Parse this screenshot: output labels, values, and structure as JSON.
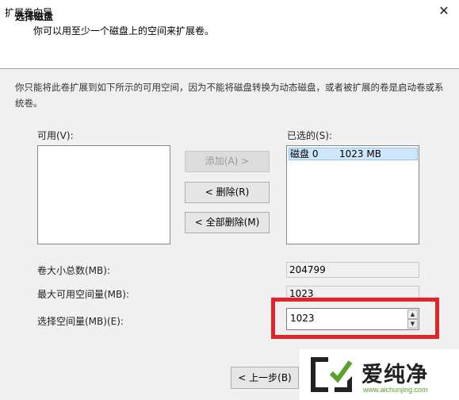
{
  "window": {
    "title": "扩展卷向导",
    "close_glyph": "✕"
  },
  "header": {
    "title": "选择磁盘",
    "subtitle": "你可以用至少一个磁盘上的空间来扩展卷。"
  },
  "description": "你只能将此卷扩展到如下所示的可用空间，因为不能将磁盘转换为动态磁盘，或者被扩展的卷是启动卷或系统卷。",
  "available": {
    "label": "可用(V):",
    "items": []
  },
  "selected": {
    "label": "已选的(S):",
    "items": [
      {
        "disk": "磁盘 0",
        "size": "1023 MB"
      }
    ]
  },
  "buttons": {
    "add": "添加(A) >",
    "remove": "< 删除(R)",
    "remove_all": "< 全部删除(M)",
    "back": "< 上一步(B)"
  },
  "fields": {
    "total_label": "卷大小总数(MB):",
    "total_value": "204799",
    "max_label": "最大可用空间量(MB):",
    "max_value": "1023",
    "select_label": "选择空间量(MB)(E):",
    "select_value": "1023"
  },
  "spinner": {
    "up": "▲",
    "down": "▼"
  },
  "watermark": {
    "text": "爱纯净",
    "url": "www.aichunjing.com"
  },
  "colors": {
    "highlight": "#e0252a",
    "selection": "#cfe6fb"
  }
}
